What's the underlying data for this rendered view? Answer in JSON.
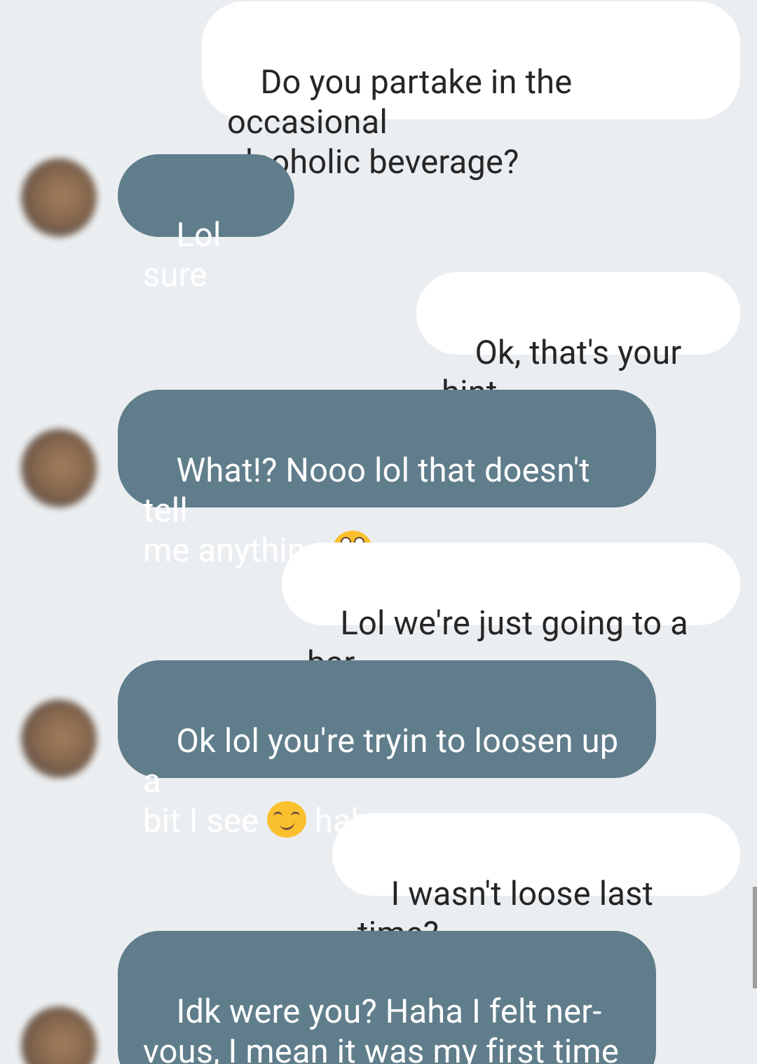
{
  "messages": [
    {
      "direction": "outgoing",
      "text": "Do you partake in the occasional\nalcoholic beverage?"
    },
    {
      "direction": "incoming",
      "text": "Lol sure"
    },
    {
      "direction": "outgoing",
      "text": "Ok, that's your hint"
    },
    {
      "direction": "incoming",
      "text_before": "What!? Nooo lol that doesn't tell\nme anything ",
      "emoji": "flushed-face-emoji"
    },
    {
      "direction": "outgoing",
      "text": "Lol we're just going to a bar"
    },
    {
      "direction": "incoming",
      "text_before": "Ok lol you're tryin to loosen up a\nbit I see ",
      "emoji": "smirking-face-emoji",
      "text_after": " haha"
    },
    {
      "direction": "outgoing",
      "text": "I wasn't loose last time?"
    },
    {
      "direction": "incoming",
      "text": "Idk were you? Haha I felt ner-\nvous, I mean it was my first time\nmeeting you, you seem calm"
    }
  ],
  "colors": {
    "background": "#ebeef1",
    "outgoing_bubble": "#ffffff",
    "incoming_bubble": "#607d8b",
    "outgoing_text": "#262626",
    "incoming_text": "#ffffff"
  }
}
